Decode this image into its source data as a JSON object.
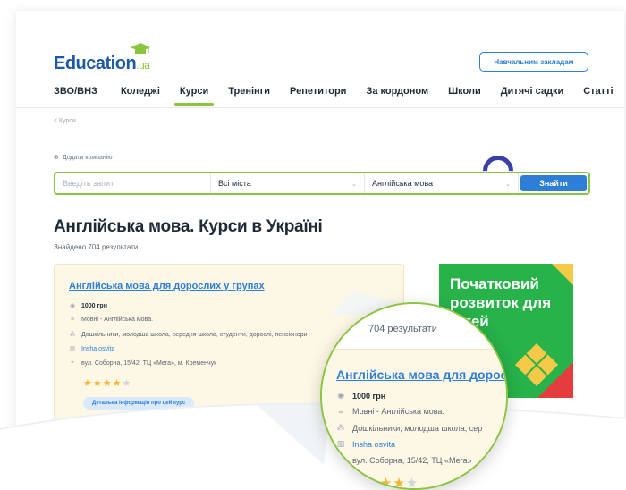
{
  "header": {
    "logo_text": "Education",
    "logo_suffix": "ua",
    "institution_button": "Навчальним закладам"
  },
  "nav": {
    "tabs": [
      {
        "label": "ЗВО/ВНЗ"
      },
      {
        "label": "Коледжі"
      },
      {
        "label": "Курси",
        "active": true
      },
      {
        "label": "Тренінги"
      },
      {
        "label": "Репетитори"
      },
      {
        "label": "За кордоном"
      },
      {
        "label": "Школи"
      },
      {
        "label": "Дитячі садки"
      },
      {
        "label": "Статті"
      }
    ]
  },
  "breadcrumb": "< Курси",
  "add_company": "Додати компанію",
  "search": {
    "placeholder": "Введіть запит",
    "city": "Всі міста",
    "subject": "Англійська мова",
    "button": "Знайти"
  },
  "page_title": "Англійська мова. Курси в Україні",
  "result_count": "Знайдено 704 результати",
  "course": {
    "title": "Англійська мова для дорослих у групах",
    "price": "1000 грн",
    "category": "Мовні - Англійська мова.",
    "audience": "Дошкільники, молодша школа, середня школа, студенти, дорослі, пенсіонери",
    "provider": "Insha osvita",
    "address": "вул. Соборна, 15/42, ТЦ «Мега», м. Кременчук",
    "rating": 4,
    "rating_max": 5,
    "details_button": "Детальна інформація про цей курс"
  },
  "promo": {
    "text": "Початковий розвиток для дітей"
  },
  "magnifier": {
    "count": "704 результати",
    "title": "Англійська мова для дорос",
    "price": "1000 грн",
    "category": "Мовні - Англійська мова.",
    "audience": "Дошкільники, молодша школа, сер",
    "provider": "Insha osvita",
    "address": "вул. Соборна, 15/42, ТЦ «Мега»"
  },
  "colors": {
    "accent_green": "#8bc53f",
    "brand_blue": "#2d7fd6",
    "promo_green": "#27b24a"
  }
}
